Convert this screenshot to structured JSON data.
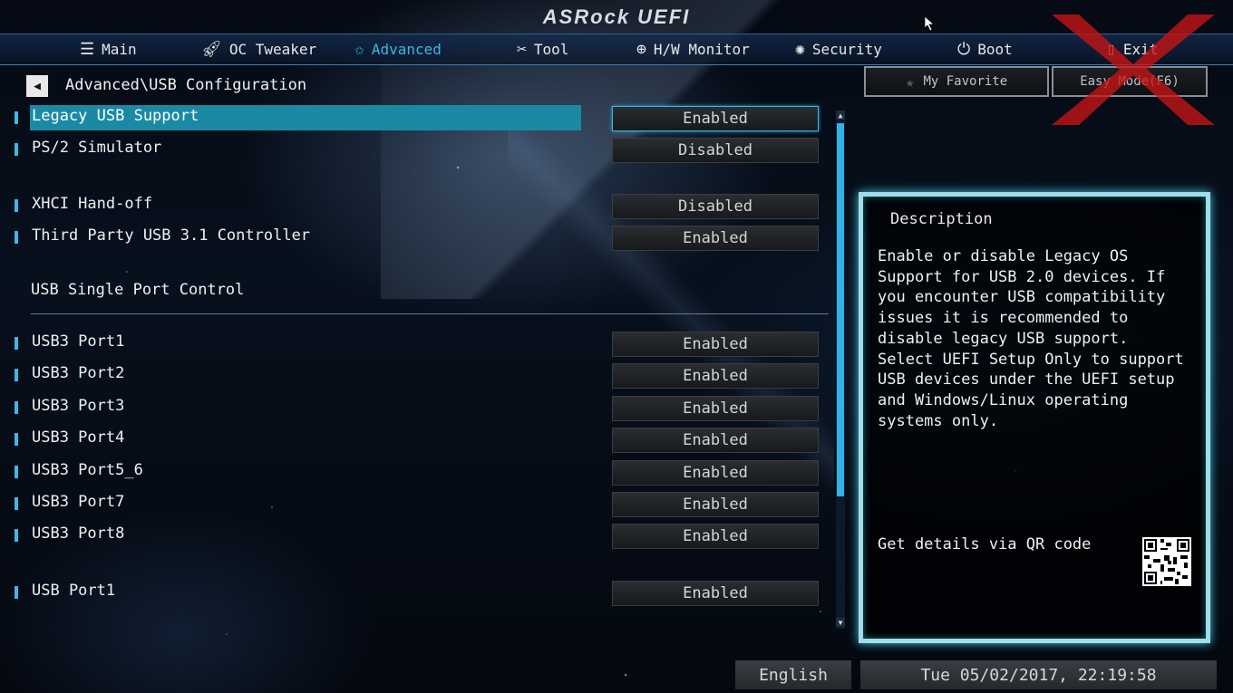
{
  "app": {
    "logo": "ASRock UEFI"
  },
  "tabs": [
    {
      "label": "Main",
      "icon": "list-icon",
      "active": false
    },
    {
      "label": "OC Tweaker",
      "icon": "rocket-icon",
      "active": false
    },
    {
      "label": "Advanced",
      "icon": "star-icon",
      "active": true
    },
    {
      "label": "Tool",
      "icon": "tools-icon",
      "active": false
    },
    {
      "label": "H/W Monitor",
      "icon": "monitor-icon",
      "active": false
    },
    {
      "label": "Security",
      "icon": "shield-icon",
      "active": false
    },
    {
      "label": "Boot",
      "icon": "power-icon",
      "active": false
    },
    {
      "label": "Exit",
      "icon": "exit-icon",
      "active": false
    }
  ],
  "breadcrumb": "Advanced\\USB Configuration",
  "buttons": {
    "favorite": "My Favorite",
    "easy_mode": "Easy Mode(F6)"
  },
  "settings": [
    {
      "label": "Legacy USB Support",
      "value": "Enabled",
      "selected": true
    },
    {
      "label": "PS/2 Simulator",
      "value": "Disabled"
    },
    {
      "label": "XHCI Hand-off",
      "value": "Disabled"
    },
    {
      "label": "Third Party USB 3.1 Controller",
      "value": "Enabled"
    },
    {
      "label": "USB3 Port1",
      "value": "Enabled"
    },
    {
      "label": "USB3 Port2",
      "value": "Enabled"
    },
    {
      "label": "USB3 Port3",
      "value": "Enabled"
    },
    {
      "label": "USB3 Port4",
      "value": "Enabled"
    },
    {
      "label": "USB3 Port5_6",
      "value": "Enabled"
    },
    {
      "label": "USB3 Port7",
      "value": "Enabled"
    },
    {
      "label": "USB3 Port8",
      "value": "Enabled"
    },
    {
      "label": "USB Port1",
      "value": "Enabled"
    }
  ],
  "section_label": "USB Single Port Control",
  "description": {
    "title": "Description",
    "text": "Enable or disable Legacy OS Support for USB 2.0 devices. If you encounter USB compatibility issues it is recommended to disable legacy USB support. Select UEFI Setup Only to support USB devices under the UEFI setup and Windows/Linux operating systems only.",
    "qr_label": "Get details via QR code"
  },
  "footer": {
    "language": "English",
    "datetime": "Tue 05/02/2017, 22:19:58"
  },
  "colors": {
    "accent": "#3ab6e6",
    "selection": "#1a8aa4",
    "panel_border": "#9fdde8"
  }
}
